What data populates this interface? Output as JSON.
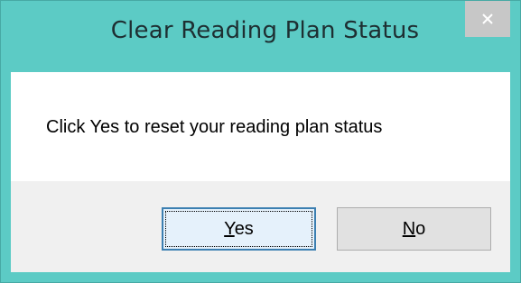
{
  "window": {
    "title": "Clear Reading Plan Status",
    "close_icon": "close-icon",
    "frame_color": "#5ccbc5"
  },
  "message": {
    "text": "Click Yes to reset your reading plan status"
  },
  "buttons": {
    "yes": {
      "mnemonic": "Y",
      "rest": "es",
      "focused": true
    },
    "no": {
      "mnemonic": "N",
      "rest": "o",
      "focused": false
    }
  }
}
